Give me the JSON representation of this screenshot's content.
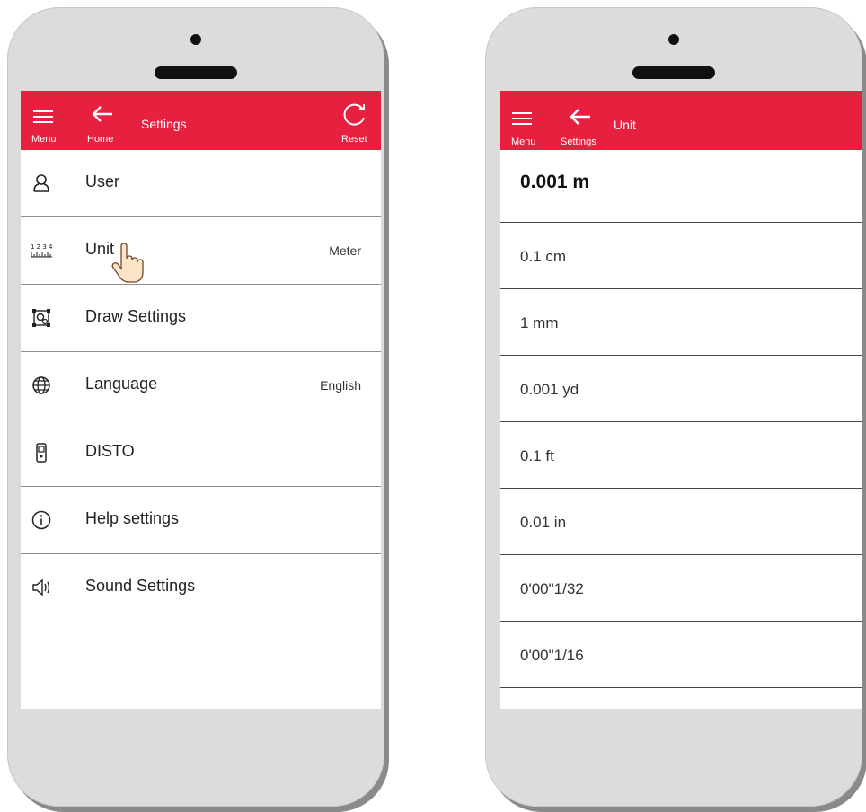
{
  "colors": {
    "accent": "#e8203f"
  },
  "left_screen": {
    "topbar": {
      "menu_caption": "Menu",
      "back_caption": "Home",
      "title": "Settings",
      "reset_caption": "Reset"
    },
    "items": [
      {
        "label": "User",
        "value": "",
        "icon": "user-icon"
      },
      {
        "label": "Unit",
        "value": "Meter",
        "icon": "ruler-icon"
      },
      {
        "label": "Draw Settings",
        "value": "",
        "icon": "draw-settings-icon"
      },
      {
        "label": "Language",
        "value": "English",
        "icon": "globe-icon"
      },
      {
        "label": "DISTO",
        "value": "",
        "icon": "disto-device-icon"
      },
      {
        "label": "Help settings",
        "value": "",
        "icon": "info-icon"
      },
      {
        "label": "Sound Settings",
        "value": "",
        "icon": "speaker-icon"
      }
    ]
  },
  "right_screen": {
    "topbar": {
      "menu_caption": "Menu",
      "back_caption": "Settings",
      "title": "Unit"
    },
    "units": [
      "0.001 m",
      "0.1 cm",
      "1 mm",
      "0.001 yd",
      "0.1 ft",
      "0.01 in",
      "0'00\"1/32",
      "0'00\"1/16"
    ],
    "selected_index": 0
  }
}
